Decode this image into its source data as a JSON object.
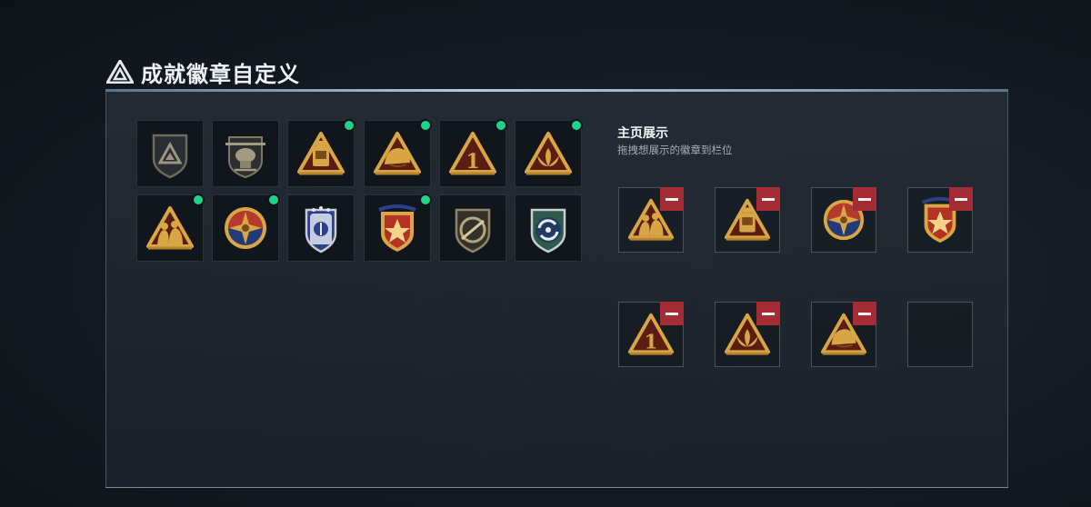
{
  "header": {
    "title": "成就徽章自定义",
    "logo_icon": "triangle-logo-icon"
  },
  "badge_grid": [
    {
      "name": "shield-triangle-badge",
      "owned": false
    },
    {
      "name": "helicopter-badge",
      "owned": false
    },
    {
      "name": "cart-triangle-badge",
      "owned": true
    },
    {
      "name": "helmet-triangle-badge",
      "owned": true
    },
    {
      "name": "number-one-triangle-badge",
      "owned": true
    },
    {
      "name": "lotus-triangle-badge",
      "owned": true
    },
    {
      "name": "soldiers-triangle-badge",
      "owned": true
    },
    {
      "name": "star-compass-badge",
      "owned": true
    },
    {
      "name": "blue-wings-shield-badge",
      "owned": false
    },
    {
      "name": "red-star-shield-badge",
      "owned": true
    },
    {
      "name": "blade-shield-badge",
      "owned": false
    },
    {
      "name": "green-arrows-shield-badge",
      "owned": false
    }
  ],
  "showcase": {
    "title": "主页展示",
    "subtitle": "拖拽想展示的徽章到栏位",
    "slots": [
      {
        "badge": "soldiers-triangle-badge"
      },
      {
        "badge": "cart-triangle-badge"
      },
      {
        "badge": "star-compass-badge"
      },
      {
        "badge": "red-star-shield-badge"
      },
      {
        "badge": "number-one-triangle-badge"
      },
      {
        "badge": "lotus-triangle-badge"
      },
      {
        "badge": "helmet-triangle-badge"
      },
      {
        "badge": null
      }
    ]
  },
  "colors": {
    "accent_green": "#1fd38a",
    "remove_red": "#a32c35",
    "badge_gold": "#d9a645",
    "badge_dark_red": "#5a1d12"
  }
}
